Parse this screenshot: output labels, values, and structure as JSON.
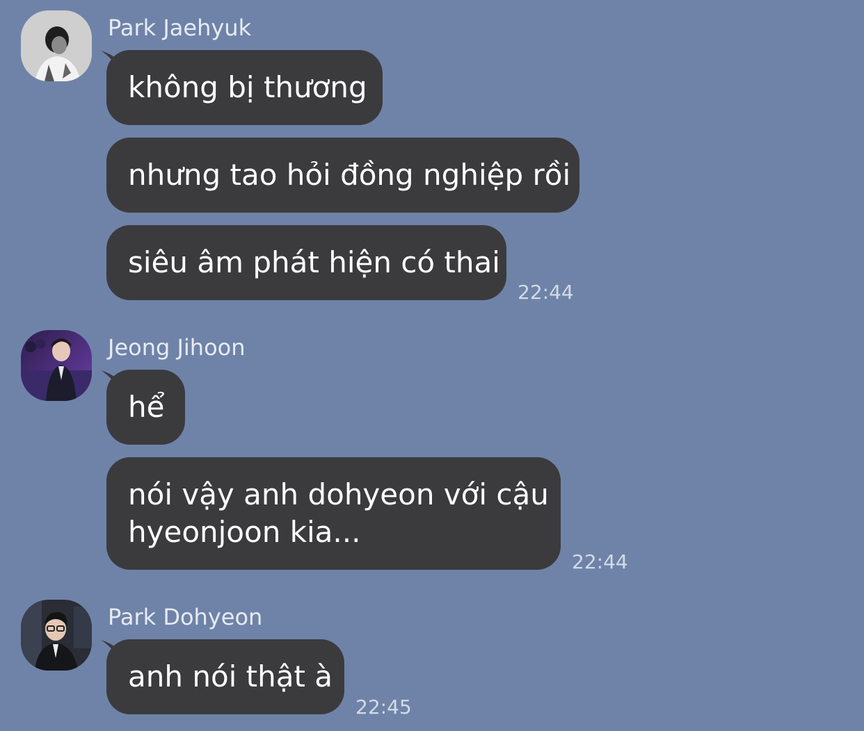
{
  "theme": {
    "background": "#6f83a8",
    "bubble": "#3b3b3e",
    "bubble_text": "#ffffff",
    "sender_text": "#e6ebf3",
    "time_text": "#d3dbe8"
  },
  "messages_groups": [
    {
      "sender": "Park Jaehyuk",
      "avatar_icon": "profile-photo-grayscale",
      "messages": [
        "không bị thương",
        "nhưng tao hỏi đồng nghiệp rồi",
        "siêu âm phát hiện có thai"
      ],
      "time": "22:44"
    },
    {
      "sender": "Jeong Jihoon",
      "avatar_icon": "profile-photo-purple",
      "messages": [
        "hể",
        "nói vậy anh dohyeon với cậu",
        "hyeonjoon kia..."
      ],
      "time": "22:44"
    },
    {
      "sender": "Park Dohyeon",
      "avatar_icon": "profile-photo-suit",
      "messages": [
        "anh nói thật à"
      ],
      "time": "22:45"
    }
  ]
}
